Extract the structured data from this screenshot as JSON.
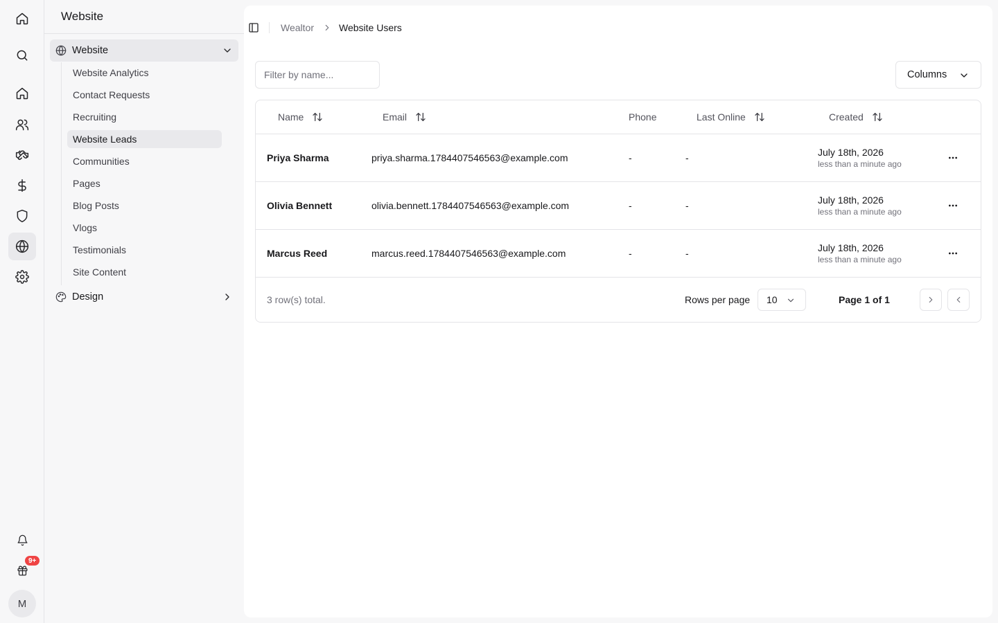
{
  "rail": {
    "items": [
      {
        "icon": "home-icon",
        "active": false
      },
      {
        "icon": "search-icon",
        "active": false
      },
      {
        "icon": "dashboard-home-icon",
        "active": false
      },
      {
        "icon": "users-icon",
        "active": false
      },
      {
        "icon": "handshake-icon",
        "active": false
      },
      {
        "icon": "dollar-icon",
        "active": false
      },
      {
        "icon": "shield-icon",
        "active": false
      },
      {
        "icon": "globe-icon",
        "active": true
      },
      {
        "icon": "gear-icon",
        "active": false
      }
    ],
    "notifications_icon": "bell-icon",
    "gift_icon": "gift-icon",
    "gift_badge": "9+",
    "avatar_initial": "M"
  },
  "sidebar": {
    "title": "Website",
    "groups": [
      {
        "label": "Website",
        "icon": "globe-icon",
        "expanded": true,
        "items": [
          {
            "label": "Website Analytics",
            "active": false
          },
          {
            "label": "Contact Requests",
            "active": false
          },
          {
            "label": "Recruiting",
            "active": false
          },
          {
            "label": "Website Leads",
            "active": true
          },
          {
            "label": "Communities",
            "active": false
          },
          {
            "label": "Pages",
            "active": false
          },
          {
            "label": "Blog Posts",
            "active": false
          },
          {
            "label": "Vlogs",
            "active": false
          },
          {
            "label": "Testimonials",
            "active": false
          },
          {
            "label": "Site Content",
            "active": false
          }
        ]
      },
      {
        "label": "Design",
        "icon": "palette-icon",
        "expanded": false
      }
    ]
  },
  "breadcrumb": {
    "root": "Wealtor",
    "current": "Website Users"
  },
  "toolbar": {
    "filter_placeholder": "Filter by name...",
    "filter_value": "",
    "columns_label": "Columns"
  },
  "table": {
    "columns": [
      {
        "label": "Name",
        "sortable": true
      },
      {
        "label": "Email",
        "sortable": true
      },
      {
        "label": "Phone",
        "sortable": false
      },
      {
        "label": "Last Online",
        "sortable": true
      },
      {
        "label": "Created",
        "sortable": true
      }
    ],
    "rows": [
      {
        "name": "Priya Sharma",
        "email": "priya.sharma.1784407546563@example.com",
        "phone": "-",
        "last_online": "-",
        "created_date": "July 18th, 2026",
        "created_ago": "less than a minute ago"
      },
      {
        "name": "Olivia Bennett",
        "email": "olivia.bennett.1784407546563@example.com",
        "phone": "-",
        "last_online": "-",
        "created_date": "July 18th, 2026",
        "created_ago": "less than a minute ago"
      },
      {
        "name": "Marcus Reed",
        "email": "marcus.reed.1784407546563@example.com",
        "phone": "-",
        "last_online": "-",
        "created_date": "July 18th, 2026",
        "created_ago": "less than a minute ago"
      }
    ],
    "footer": {
      "total": "3 row(s) total.",
      "rows_per_page_label": "Rows per page",
      "rows_per_page_value": "10",
      "page_label": "Page 1 of 1"
    }
  },
  "colors": {
    "badge": "#ef4444",
    "active_bg": "#e9e9ec",
    "border": "#e4e4e7"
  }
}
